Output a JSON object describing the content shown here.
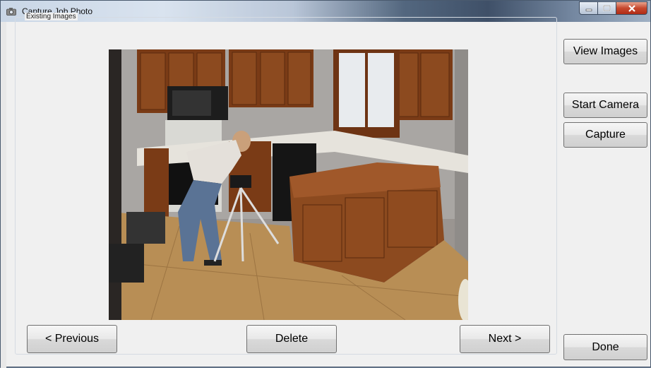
{
  "window": {
    "title": "Capture Job Photo"
  },
  "group": {
    "label": "Existing Images"
  },
  "buttons": {
    "view_images": "View Images",
    "start_camera": "Start Camera",
    "capture": "Capture",
    "done": "Done",
    "previous": "< Previous",
    "delete": "Delete",
    "next": "Next >"
  },
  "photo": {
    "subject": "kitchen-photo"
  },
  "colors": {
    "titlebar_dark": "#3f5068",
    "close_red": "#c7482e",
    "button_face": "#e8e8e8"
  }
}
